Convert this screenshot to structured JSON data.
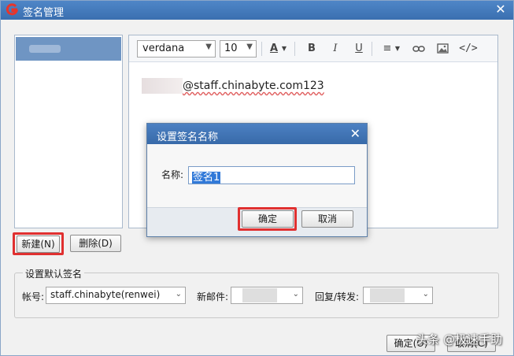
{
  "window": {
    "title": "签名管理",
    "close_glyph": "✕"
  },
  "editor": {
    "font": "verdana",
    "font_size": "10",
    "content_email": "@staff.chinabyte.com123"
  },
  "left_buttons": {
    "new_label": "新建(N)",
    "delete_label": "删除(D)"
  },
  "default_group": {
    "title": "设置默认签名",
    "account_label": "帐号:",
    "account_value": "staff.chinabyte(renwei)",
    "new_mail_label": "新邮件:",
    "reply_label": "回复/转发:"
  },
  "bottom_buttons": {
    "ok_label": "确定(O)",
    "cancel_label": "取消(C)"
  },
  "dialog": {
    "title": "设置签名名称",
    "name_label": "名称:",
    "name_value": "签名1",
    "ok_label": "确定",
    "cancel_label": "取消"
  },
  "watermark": "头条 @极速手助",
  "colors": {
    "titlebar": "#3a6fb0",
    "highlight": "#e03030",
    "selection": "#3179d8"
  }
}
